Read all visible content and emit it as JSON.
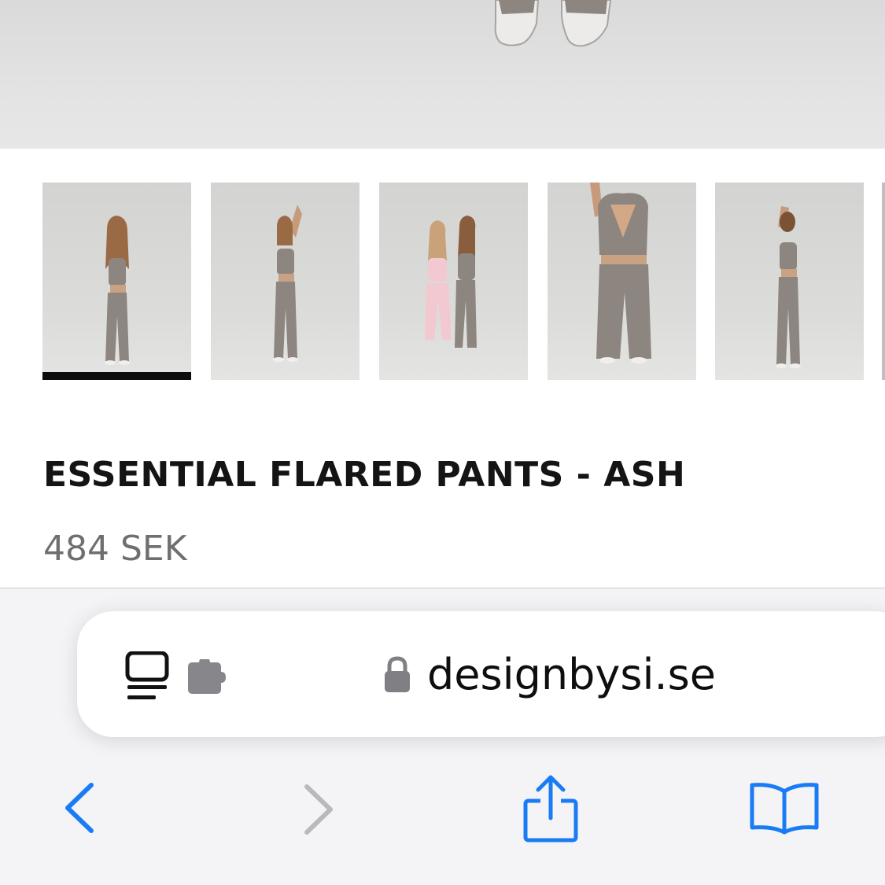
{
  "product": {
    "title": "ESSENTIAL FLARED PANTS - ASH",
    "price": "484 SEK"
  },
  "gallery": {
    "active_index": 0,
    "thumbnails": [
      "thumbnail-1",
      "thumbnail-2",
      "thumbnail-3",
      "thumbnail-4",
      "thumbnail-5"
    ]
  },
  "browser": {
    "domain": "designbysi.se",
    "page_menu_icon": "page-menu-icon",
    "extension_icon": "puzzle-icon",
    "lock_icon": "lock-icon",
    "toolbar": [
      "back-icon",
      "forward-icon",
      "share-icon",
      "bookmarks-icon"
    ]
  },
  "colors": {
    "accent": "#1a7cf5",
    "disabled": "#b9b9bd",
    "title": "#141414",
    "price": "#6f6f6f",
    "outfit": "#8d8580"
  }
}
